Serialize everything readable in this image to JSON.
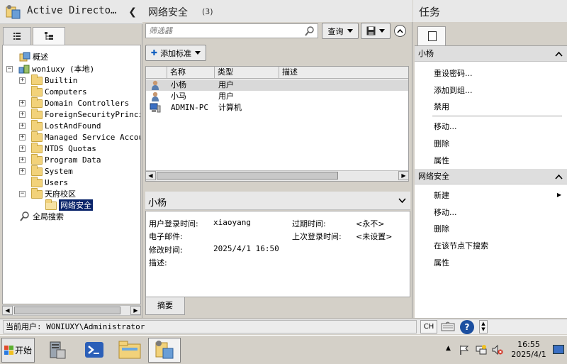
{
  "left_pane": {
    "title": "Active Directo…",
    "collapse_glyph": "❮",
    "tabs": [
      {
        "name": "list-view",
        "icon": "list-icon"
      },
      {
        "name": "tree-view",
        "icon": "tree-icon"
      }
    ],
    "tree": {
      "overview": "概述",
      "domain": "woniuxy (本地)",
      "children": [
        "Builtin",
        "Computers",
        "Domain Controllers",
        "ForeignSecurityPrincip",
        "LostAndFound",
        "Managed Service Accour",
        "NTDS Quotas",
        "Program Data",
        "System",
        "Users"
      ],
      "tianfu": "天府校区",
      "selected": "网络安全",
      "global_search": "全局搜索"
    }
  },
  "middle_pane": {
    "title": "网络安全",
    "count": "(3)",
    "filter_placeholder": "筛选器",
    "query_label": "查询",
    "add_criteria_label": "添加标准",
    "columns": [
      "名称",
      "类型",
      "描述"
    ],
    "rows": [
      {
        "name": "小杨",
        "type": "用户",
        "icon": "user-icon"
      },
      {
        "name": "小马",
        "type": "用户",
        "icon": "user-icon"
      },
      {
        "name": "ADMIN-PC",
        "type": "计算机",
        "icon": "computer-icon"
      }
    ],
    "detail": {
      "name": "小杨",
      "login_label": "用户登录时间:",
      "login_value": "xiaoyang",
      "expire_label": "过期时间:",
      "expire_value": "<永不>",
      "email_label": "电子邮件:",
      "last_login_label": "上次登录时间:",
      "last_login_value": "<未设置>",
      "modified_label": "修改时间:",
      "modified_value": "2025/4/1 16:50",
      "desc_label": "描述:"
    },
    "summary_tab": "摘要"
  },
  "right_pane": {
    "title": "任务",
    "section1": "小杨",
    "section1_actions": [
      "重设密码...",
      "添加到组...",
      "禁用",
      "移动...",
      "删除",
      "属性"
    ],
    "section2": "网络安全",
    "section2_actions": [
      "新建",
      "移动...",
      "删除",
      "在该节点下搜索",
      "属性"
    ]
  },
  "statusbar": {
    "current_user": "当前用户: WONIUXY\\Administrator",
    "lang": "CH",
    "help": "?"
  },
  "taskbar": {
    "start": "开始",
    "time": "16:55",
    "date": "2025/4/1"
  },
  "colors": {
    "selection": "#0a246a",
    "highlight_row": "#d9d9d9",
    "accent": "#1c4fa0"
  }
}
